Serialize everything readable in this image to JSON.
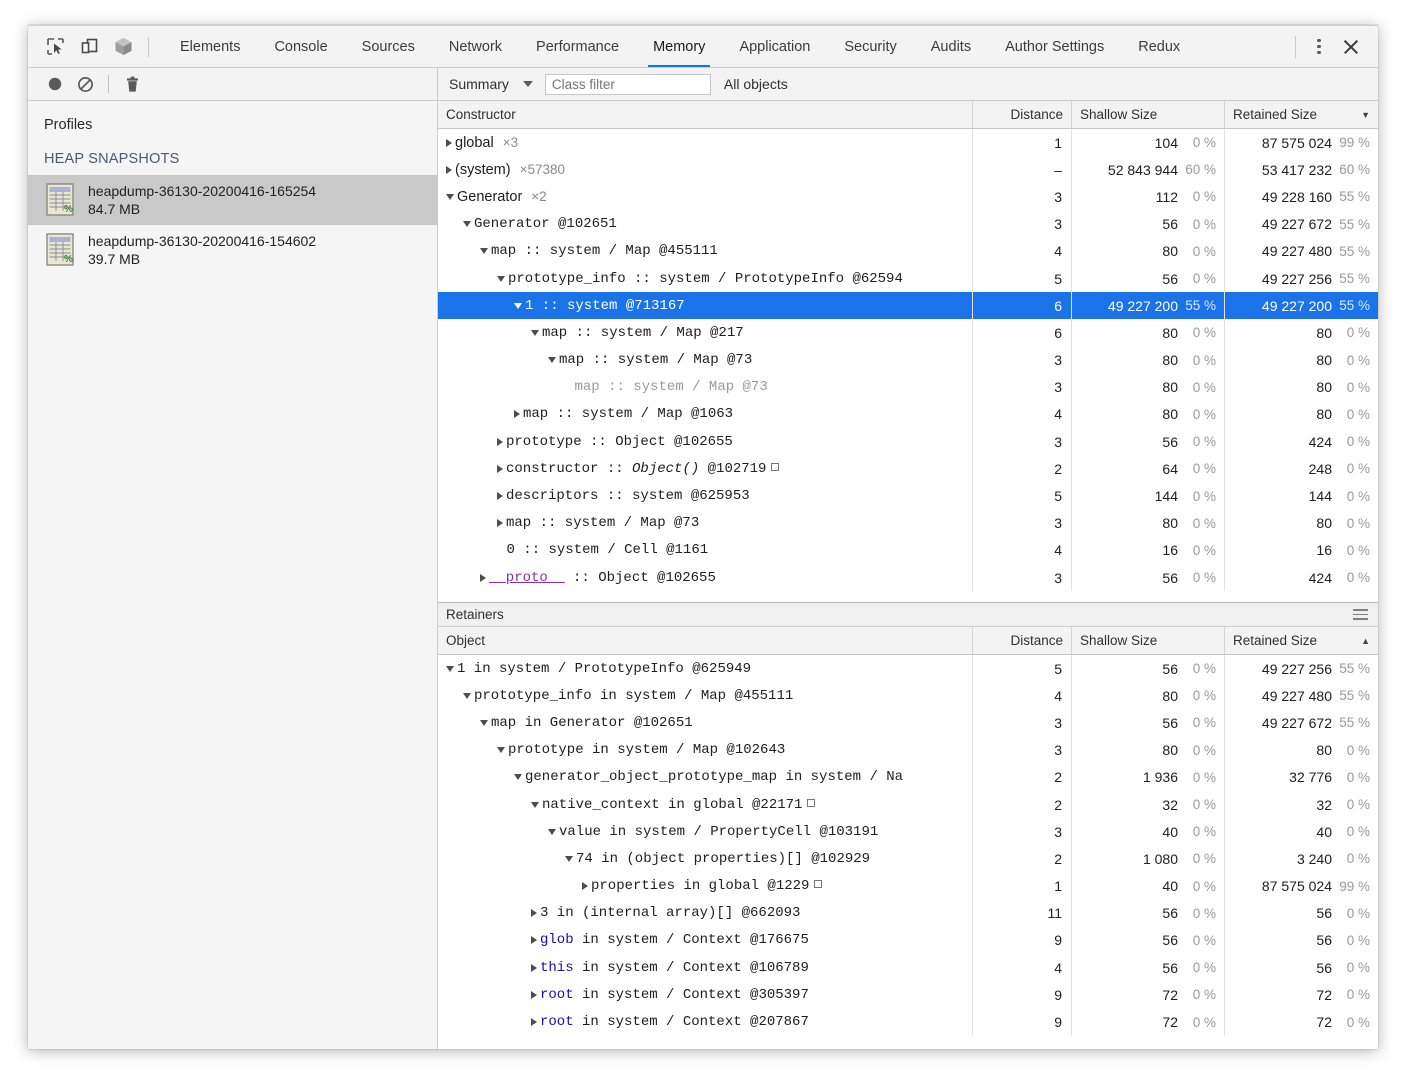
{
  "window": {
    "toolbar_icons": [
      "inspect-element-icon",
      "device-toolbar-icon",
      "cube-3d-icon"
    ],
    "tabs": [
      {
        "label": "Elements",
        "active": false
      },
      {
        "label": "Console",
        "active": false
      },
      {
        "label": "Sources",
        "active": false
      },
      {
        "label": "Network",
        "active": false
      },
      {
        "label": "Performance",
        "active": false
      },
      {
        "label": "Memory",
        "active": true
      },
      {
        "label": "Application",
        "active": false
      },
      {
        "label": "Security",
        "active": false
      },
      {
        "label": "Audits",
        "active": false
      },
      {
        "label": "Author Settings",
        "active": false
      },
      {
        "label": "Redux",
        "active": false
      }
    ],
    "more_label": "more-options",
    "close_label": "close"
  },
  "toolbar2": {
    "record_icon": "record-circle-icon",
    "clear_icon": "ban-clear-icon",
    "trash_icon": "trash-icon",
    "view_selector": "Summary",
    "class_filter_placeholder": "Class filter",
    "class_filter_value": "",
    "objects_scope": "All objects"
  },
  "sidebar": {
    "title": "Profiles",
    "group_label": "HEAP SNAPSHOTS",
    "snapshots": [
      {
        "name": "heapdump-36130-20200416-165254",
        "size": "84.7 MB",
        "selected": true
      },
      {
        "name": "heapdump-36130-20200416-154602",
        "size": "39.7 MB",
        "selected": false
      }
    ]
  },
  "constructors": {
    "columns": [
      "Constructor",
      "Distance",
      "Shallow Size",
      "Retained Size"
    ],
    "sort_column": "Retained Size",
    "sort_dir": "desc",
    "rows": [
      {
        "indent": 0,
        "tri": "closed",
        "font": "sans",
        "text": "global",
        "count": "×3",
        "distance": "1",
        "shallow": "104",
        "shallow_pct": "0 %",
        "retained": "87 575 024",
        "retained_pct": "99 %"
      },
      {
        "indent": 0,
        "tri": "closed",
        "font": "sans",
        "text": "(system)",
        "count": "×57380",
        "distance": "–",
        "shallow": "52 843 944",
        "shallow_pct": "60 %",
        "retained": "53 417 232",
        "retained_pct": "60 %"
      },
      {
        "indent": 0,
        "tri": "open",
        "font": "sans",
        "text": "Generator",
        "count": "×2",
        "distance": "3",
        "shallow": "112",
        "shallow_pct": "0 %",
        "retained": "49 228 160",
        "retained_pct": "55 %"
      },
      {
        "indent": 1,
        "tri": "open",
        "font": "mono",
        "text": "Generator @102651",
        "count": "",
        "distance": "3",
        "shallow": "56",
        "shallow_pct": "0 %",
        "retained": "49 227 672",
        "retained_pct": "55 %"
      },
      {
        "indent": 2,
        "tri": "open",
        "font": "mono",
        "text": "map :: system / Map @455111",
        "count": "",
        "distance": "4",
        "shallow": "80",
        "shallow_pct": "0 %",
        "retained": "49 227 480",
        "retained_pct": "55 %"
      },
      {
        "indent": 3,
        "tri": "open",
        "font": "mono",
        "text": "prototype_info :: system / PrototypeInfo @62594",
        "count": "",
        "distance": "5",
        "shallow": "56",
        "shallow_pct": "0 %",
        "retained": "49 227 256",
        "retained_pct": "55 %"
      },
      {
        "indent": 4,
        "tri": "open",
        "font": "mono",
        "text": "1 :: system @713167",
        "count": "",
        "distance": "6",
        "shallow": "49 227 200",
        "shallow_pct": "55 %",
        "retained": "49 227 200",
        "retained_pct": "55 %",
        "selected": true
      },
      {
        "indent": 5,
        "tri": "open",
        "font": "mono",
        "text": "map :: system / Map @217",
        "count": "",
        "distance": "6",
        "shallow": "80",
        "shallow_pct": "0 %",
        "retained": "80",
        "retained_pct": "0 %"
      },
      {
        "indent": 6,
        "tri": "open",
        "font": "mono",
        "text": "map :: system / Map @73",
        "count": "",
        "distance": "3",
        "shallow": "80",
        "shallow_pct": "0 %",
        "retained": "80",
        "retained_pct": "0 %"
      },
      {
        "indent": 7,
        "tri": "none",
        "font": "mono",
        "dim": true,
        "text": "map :: system / Map @73",
        "count": "",
        "distance": "3",
        "shallow": "80",
        "shallow_pct": "0 %",
        "retained": "80",
        "retained_pct": "0 %"
      },
      {
        "indent": 4,
        "tri": "closed",
        "font": "mono",
        "text": "map :: system / Map @1063",
        "count": "",
        "distance": "4",
        "shallow": "80",
        "shallow_pct": "0 %",
        "retained": "80",
        "retained_pct": "0 %"
      },
      {
        "indent": 3,
        "tri": "closed",
        "font": "mono",
        "text": "prototype :: Object @102655",
        "count": "",
        "distance": "3",
        "shallow": "56",
        "shallow_pct": "0 %",
        "retained": "424",
        "retained_pct": "0 %"
      },
      {
        "indent": 3,
        "tri": "closed",
        "font": "mono",
        "text": "constructor :: Object() @102719",
        "count": "",
        "box": true,
        "italic_part": "Object()",
        "distance": "2",
        "shallow": "64",
        "shallow_pct": "0 %",
        "retained": "248",
        "retained_pct": "0 %"
      },
      {
        "indent": 3,
        "tri": "closed",
        "font": "mono",
        "text": "descriptors :: system @625953",
        "count": "",
        "distance": "5",
        "shallow": "144",
        "shallow_pct": "0 %",
        "retained": "144",
        "retained_pct": "0 %"
      },
      {
        "indent": 3,
        "tri": "closed",
        "font": "mono",
        "text": "map :: system / Map @73",
        "count": "",
        "distance": "3",
        "shallow": "80",
        "shallow_pct": "0 %",
        "retained": "80",
        "retained_pct": "0 %"
      },
      {
        "indent": 3,
        "tri": "none",
        "font": "mono",
        "text": "0 :: system / Cell @1161",
        "count": "",
        "distance": "4",
        "shallow": "16",
        "shallow_pct": "0 %",
        "retained": "16",
        "retained_pct": "0 %"
      },
      {
        "indent": 2,
        "tri": "closed",
        "font": "mono",
        "text": "__proto__ :: Object @102655",
        "key": "__proto__",
        "key_style": "purple",
        "count": "",
        "distance": "3",
        "shallow": "56",
        "shallow_pct": "0 %",
        "retained": "424",
        "retained_pct": "0 %"
      }
    ]
  },
  "retainers": {
    "panel_title": "Retainers",
    "menu_icon": "hamburger-menu-icon",
    "columns": [
      "Object",
      "Distance",
      "Shallow Size",
      "Retained Size"
    ],
    "sort_column": "Retained Size",
    "sort_dir": "asc",
    "rows": [
      {
        "indent": 0,
        "tri": "open",
        "text": "1 in system / PrototypeInfo @625949",
        "distance": "5",
        "shallow": "56",
        "shallow_pct": "0 %",
        "retained": "49 227 256",
        "retained_pct": "55 %"
      },
      {
        "indent": 1,
        "tri": "open",
        "text": "prototype_info in system / Map @455111",
        "distance": "4",
        "shallow": "80",
        "shallow_pct": "0 %",
        "retained": "49 227 480",
        "retained_pct": "55 %"
      },
      {
        "indent": 2,
        "tri": "open",
        "text": "map in Generator @102651",
        "distance": "3",
        "shallow": "56",
        "shallow_pct": "0 %",
        "retained": "49 227 672",
        "retained_pct": "55 %"
      },
      {
        "indent": 3,
        "tri": "open",
        "text": "prototype in system / Map @102643",
        "distance": "3",
        "shallow": "80",
        "shallow_pct": "0 %",
        "retained": "80",
        "retained_pct": "0 %"
      },
      {
        "indent": 4,
        "tri": "open",
        "text": "generator_object_prototype_map in system / Na",
        "distance": "2",
        "shallow": "1 936",
        "shallow_pct": "0 %",
        "retained": "32 776",
        "retained_pct": "0 %"
      },
      {
        "indent": 5,
        "tri": "open",
        "text": "native_context in global @22171",
        "box": true,
        "distance": "2",
        "shallow": "32",
        "shallow_pct": "0 %",
        "retained": "32",
        "retained_pct": "0 %"
      },
      {
        "indent": 6,
        "tri": "open",
        "text": "value in system / PropertyCell @103191",
        "distance": "3",
        "shallow": "40",
        "shallow_pct": "0 %",
        "retained": "40",
        "retained_pct": "0 %"
      },
      {
        "indent": 7,
        "tri": "open",
        "text": "74 in (object properties)[] @102929",
        "distance": "2",
        "shallow": "1 080",
        "shallow_pct": "0 %",
        "retained": "3 240",
        "retained_pct": "0 %"
      },
      {
        "indent": 8,
        "tri": "closed",
        "text": "properties in global @1229",
        "box": true,
        "distance": "1",
        "shallow": "40",
        "shallow_pct": "0 %",
        "retained": "87 575 024",
        "retained_pct": "99 %"
      },
      {
        "indent": 5,
        "tri": "closed",
        "text": "3 in (internal array)[] @662093",
        "distance": "11",
        "shallow": "56",
        "shallow_pct": "0 %",
        "retained": "56",
        "retained_pct": "0 %"
      },
      {
        "indent": 5,
        "tri": "closed",
        "text": "glob in system / Context @176675",
        "key": "glob",
        "key_style": "blue",
        "distance": "9",
        "shallow": "56",
        "shallow_pct": "0 %",
        "retained": "56",
        "retained_pct": "0 %"
      },
      {
        "indent": 5,
        "tri": "closed",
        "text": "this in system / Context @106789",
        "key": "this",
        "key_style": "blue",
        "distance": "4",
        "shallow": "56",
        "shallow_pct": "0 %",
        "retained": "56",
        "retained_pct": "0 %"
      },
      {
        "indent": 5,
        "tri": "closed",
        "text": "root in system / Context @305397",
        "key": "root",
        "key_style": "blue",
        "distance": "9",
        "shallow": "72",
        "shallow_pct": "0 %",
        "retained": "72",
        "retained_pct": "0 %"
      },
      {
        "indent": 5,
        "tri": "closed",
        "text": "root in system / Context @207867",
        "key": "root",
        "key_style": "blue",
        "distance": "9",
        "shallow": "72",
        "shallow_pct": "0 %",
        "retained": "72",
        "retained_pct": "0 %"
      }
    ]
  },
  "colors": {
    "accent": "#1a73e8",
    "toolbar_bg": "#f3f3f3",
    "sidebar_bg": "#f5f5f5",
    "selected_row": "#1a73e8",
    "group_label": "#4a5a74"
  }
}
